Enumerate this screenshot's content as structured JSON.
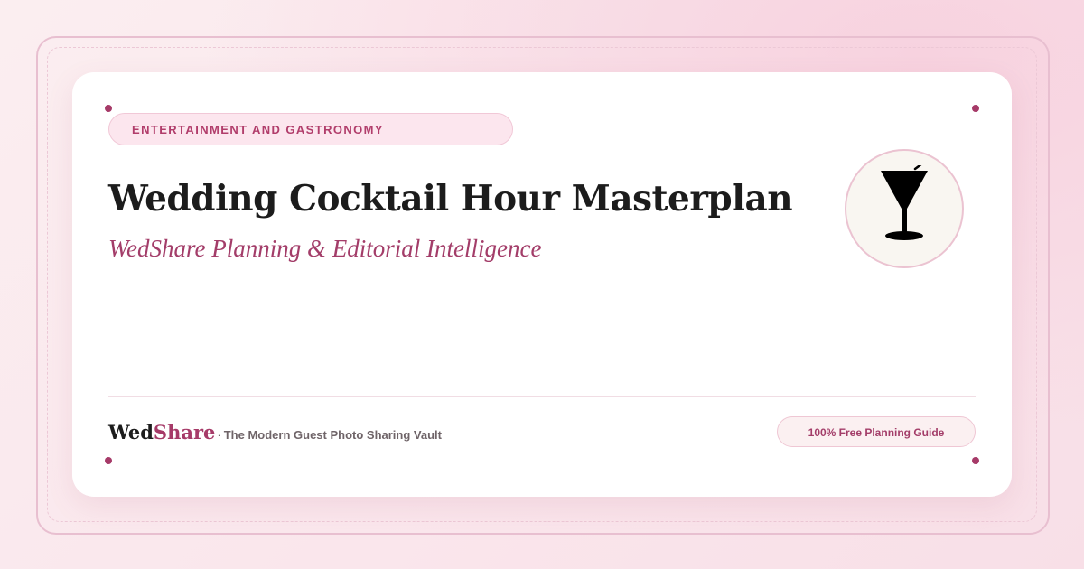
{
  "category": {
    "label": "ENTERTAINMENT AND GASTRONOMY"
  },
  "header": {
    "title": "Wedding Cocktail Hour Masterplan",
    "subtitle": "WedShare Planning & Editorial Intelligence"
  },
  "hero_icon": {
    "name": "cocktail-glass-icon"
  },
  "footer": {
    "brand_primary": "Wed",
    "brand_accent": "Share",
    "separator": "·",
    "tagline": "The Modern Guest Photo Sharing Vault",
    "badge": "100% Free Planning Guide"
  },
  "colors": {
    "accent": "#a63a68",
    "title_text": "#1c1c1c",
    "pill_background": "#fce6ee",
    "icon_background": "#f9f6f1"
  }
}
